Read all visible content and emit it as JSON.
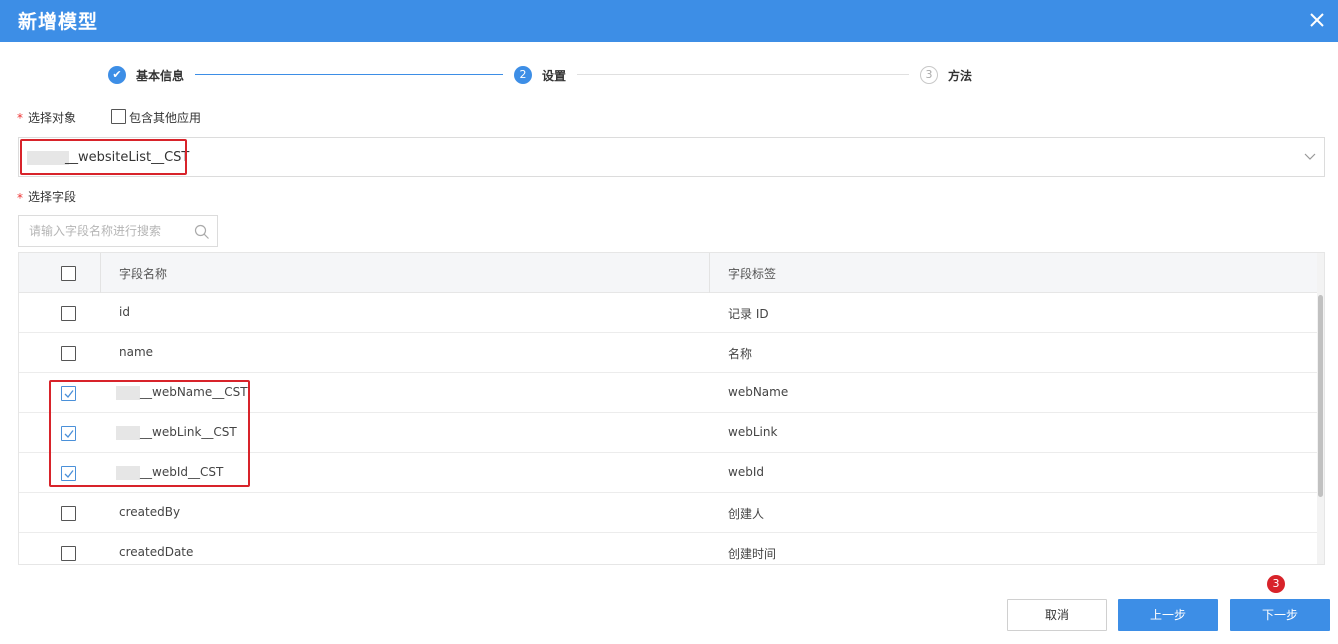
{
  "dialog": {
    "title": "新增模型",
    "close_icon": "close-icon"
  },
  "steps": [
    {
      "label": "基本信息",
      "marker": "✔",
      "state": "done"
    },
    {
      "label": "设置",
      "marker": "2",
      "state": "active"
    },
    {
      "label": "方法",
      "marker": "3",
      "state": "todo"
    }
  ],
  "object_section": {
    "label": "选择对象",
    "required_mark": "*",
    "include_other_apps_label": "包含其他应用",
    "include_other_apps_checked": false,
    "selected_value": "__websiteList__CST",
    "dropdown_icon": "chevron-down-icon"
  },
  "field_section": {
    "label": "选择字段",
    "required_mark": "*",
    "search_placeholder": "请输入字段名称进行搜索",
    "search_value": ""
  },
  "table": {
    "columns": [
      "字段名称",
      "字段标签"
    ],
    "rows": [
      {
        "name": "id",
        "label": "记录 ID",
        "checked": false
      },
      {
        "name": "name",
        "label": "名称",
        "checked": false
      },
      {
        "name": "__webName__CST",
        "label": "webName",
        "checked": true
      },
      {
        "name": "__webLink__CST",
        "label": "webLink",
        "checked": true
      },
      {
        "name": "__webId__CST",
        "label": "webId",
        "checked": true
      },
      {
        "name": "createdBy",
        "label": "创建人",
        "checked": false
      },
      {
        "name": "createdDate",
        "label": "创建时间",
        "checked": false
      }
    ]
  },
  "footer": {
    "cancel_label": "取消",
    "prev_label": "上一步",
    "next_label": "下一步",
    "callout_number": "3"
  },
  "colors": {
    "header": "#3d8ee6",
    "primary": "#3d8ee6",
    "highlight": "#d8232a"
  }
}
